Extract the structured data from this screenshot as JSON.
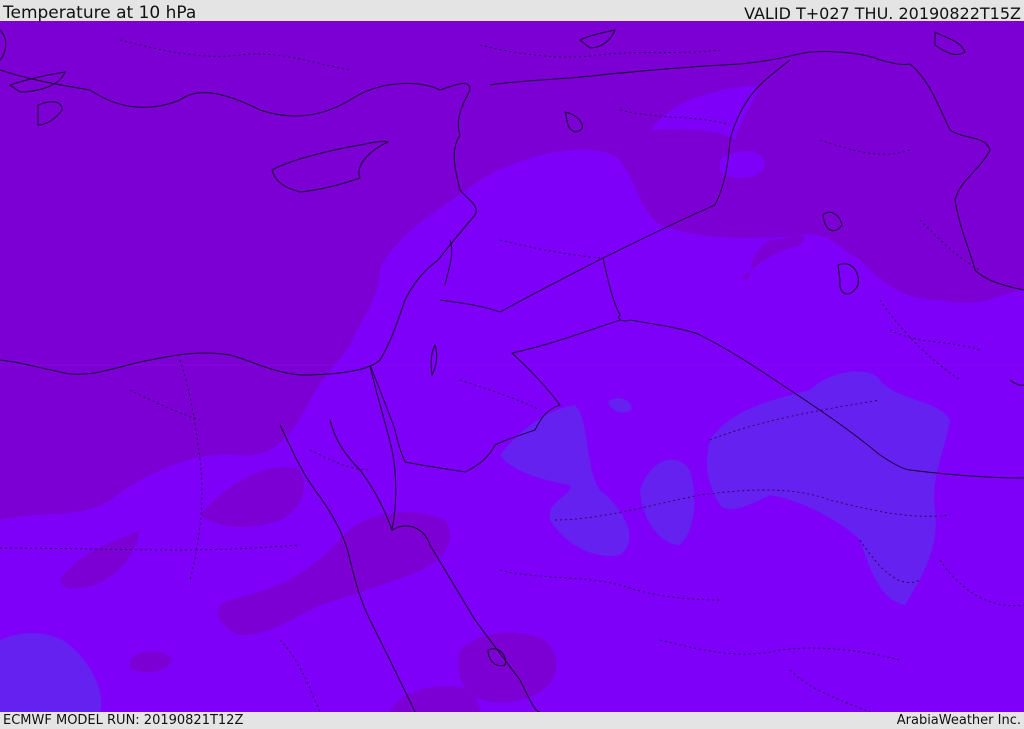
{
  "header": {
    "title": "Temperature at 10 hPa",
    "valid": "VALID T+027 THU. 20190822T15Z"
  },
  "footer": {
    "model_run": "ECMWF MODEL RUN: 20190821T12Z",
    "credit": "ArabiaWeather Inc."
  },
  "colors": {
    "background": "#e4e4e4",
    "band_dark": "#7c00d4",
    "band_mid": "#7e00f8",
    "band_cool": "#6421f0",
    "coastline": "#1a0030"
  }
}
